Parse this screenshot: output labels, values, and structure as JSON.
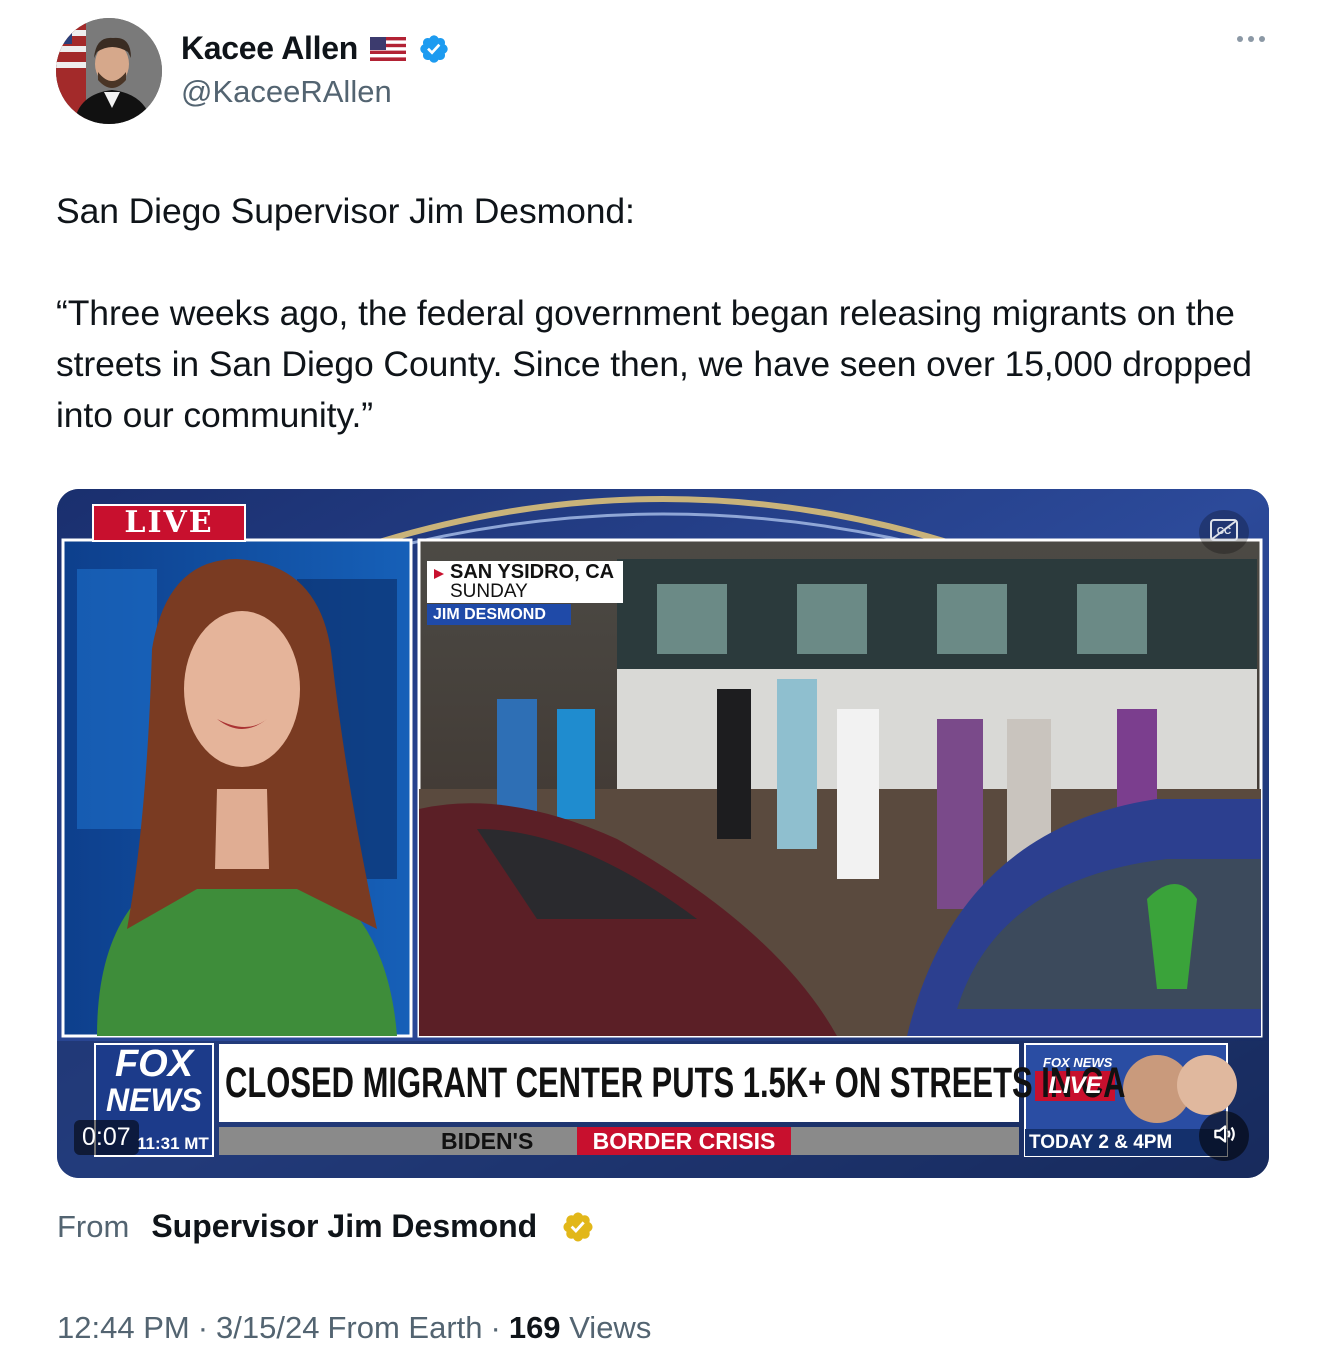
{
  "author": {
    "display_name": "Kacee Allen",
    "handle": "@KaceeRAllen",
    "flag_icon": "us-flag-icon",
    "verified_icon": "verified-badge-icon",
    "verified_color": "#1d9bf0"
  },
  "tweet": {
    "text": "San Diego Supervisor Jim Desmond:\n\n“Three weeks ago, the federal government began releasing migrants on the streets in San Diego County. Since then, we have seen over 15,000 dropped into our community.”"
  },
  "video": {
    "live_label": "LIVE",
    "location_line1": "SAN YSIDRO, CA",
    "location_line2": "SUNDAY",
    "location_name": "JIM DESMOND",
    "headline": "CLOSED MIGRANT CENTER PUTS 1.5K+ ON STREETS IN CA",
    "network_line1": "FOX",
    "network_line2": "NEWS",
    "time_zone": "11:31 MT",
    "sub_ticker_prefix": "BIDEN'S",
    "sub_ticker_highlight": "BORDER CRISIS",
    "promo_brand": "FOX NEWS",
    "promo_live": "LIVE",
    "promo_time": "TODAY 2 & 4PM",
    "elapsed": "0:07",
    "mute_icon": "speaker-icon",
    "captions_icon": "captions-icon"
  },
  "source": {
    "from_label": "From",
    "from_name": "Supervisor Jim Desmond",
    "badge_icon": "gold-verified-badge-icon",
    "badge_color": "#e2b719"
  },
  "meta": {
    "time": "12:44 PM",
    "separator": "·",
    "date": "3/15/24",
    "client": "From Earth",
    "views_count": "169",
    "views_label": "Views"
  }
}
